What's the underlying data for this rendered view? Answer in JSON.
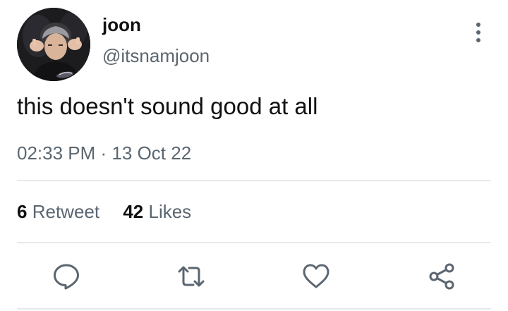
{
  "tweet": {
    "author": {
      "display_name": "joon",
      "handle": "@itsnamjoon",
      "avatar_icon": "profile-photo"
    },
    "text": "this doesn't sound good at all",
    "time": "02:33 PM",
    "separator": "·",
    "date": "13 Oct 22",
    "stats": {
      "retweets_count": "6",
      "retweets_label": "Retweet",
      "likes_count": "42",
      "likes_label": "Likes"
    },
    "actions": [
      {
        "name": "reply",
        "icon": "speech-bubble-icon"
      },
      {
        "name": "retweet",
        "icon": "retweet-arrows-icon"
      },
      {
        "name": "like",
        "icon": "heart-icon"
      },
      {
        "name": "share",
        "icon": "share-nodes-icon"
      }
    ],
    "menu_icon": "vertical-dots-icon"
  },
  "colors": {
    "primary_text": "#111111",
    "secondary_text": "#5b6670",
    "divider": "#e6e9ec",
    "background": "#ffffff"
  }
}
